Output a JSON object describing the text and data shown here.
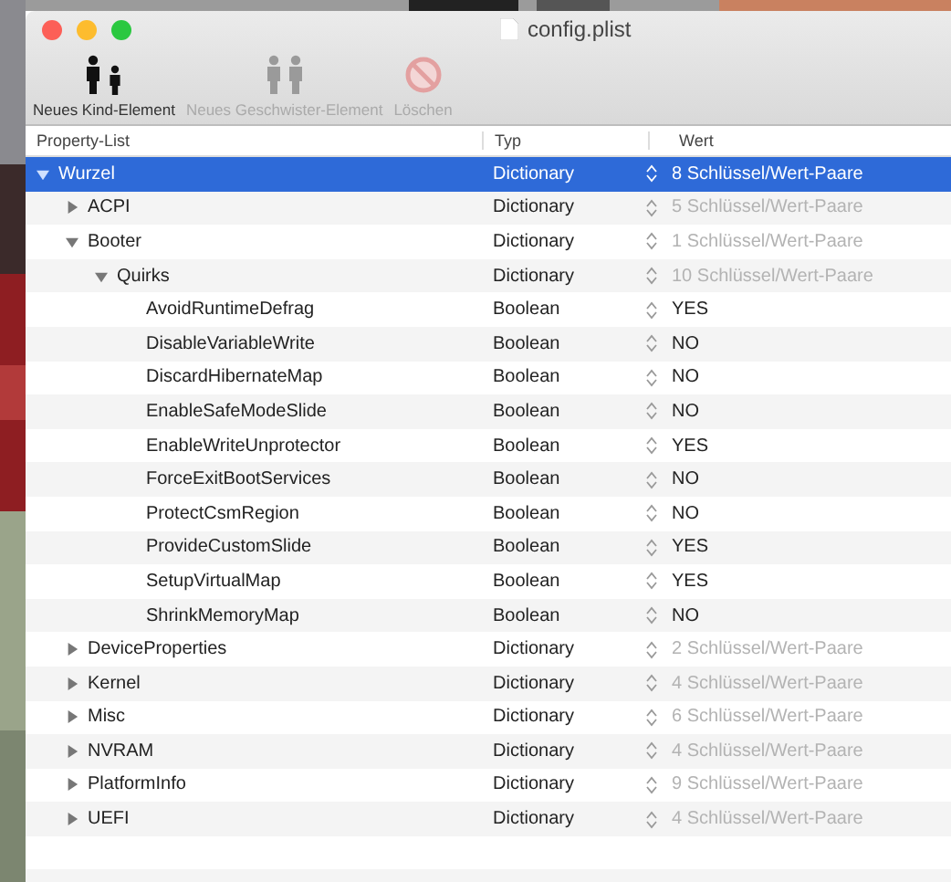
{
  "window": {
    "title": "config.plist"
  },
  "toolbar": [
    {
      "label": "Neues Kind-Element",
      "kind": "child",
      "disabled": false
    },
    {
      "label": "Neues Geschwister-Element",
      "kind": "sibling",
      "disabled": true
    },
    {
      "label": "Löschen",
      "kind": "delete",
      "disabled": true
    }
  ],
  "table": {
    "columns": [
      "Property-List",
      "Typ",
      "Wert"
    ],
    "rows": [
      {
        "key": "Wurzel",
        "type": "Dictionary",
        "kind": "dictionary",
        "value": "8 Schlüssel/Wert-Paare",
        "selected": true,
        "expanded": true,
        "children": [
          {
            "key": "ACPI",
            "type": "Dictionary",
            "kind": "dictionary",
            "value": "5 Schlüssel/Wert-Paare",
            "selected": false,
            "expanded": false
          },
          {
            "key": "Booter",
            "type": "Dictionary",
            "kind": "dictionary",
            "value": "1 Schlüssel/Wert-Paare",
            "selected": false,
            "expanded": true,
            "children": [
              {
                "key": "Quirks",
                "type": "Dictionary",
                "kind": "dictionary",
                "value": "10 Schlüssel/Wert-Paare",
                "selected": false,
                "expanded": true,
                "children": [
                  {
                    "key": "AvoidRuntimeDefrag",
                    "type": "Boolean",
                    "kind": "boolean",
                    "value": "YES",
                    "selected": false
                  },
                  {
                    "key": "DisableVariableWrite",
                    "type": "Boolean",
                    "kind": "boolean",
                    "value": "NO",
                    "selected": false
                  },
                  {
                    "key": "DiscardHibernateMap",
                    "type": "Boolean",
                    "kind": "boolean",
                    "value": "NO",
                    "selected": false
                  },
                  {
                    "key": "EnableSafeModeSlide",
                    "type": "Boolean",
                    "kind": "boolean",
                    "value": "NO",
                    "selected": false
                  },
                  {
                    "key": "EnableWriteUnprotector",
                    "type": "Boolean",
                    "kind": "boolean",
                    "value": "YES",
                    "selected": false
                  },
                  {
                    "key": "ForceExitBootServices",
                    "type": "Boolean",
                    "kind": "boolean",
                    "value": "NO",
                    "selected": false
                  },
                  {
                    "key": "ProtectCsmRegion",
                    "type": "Boolean",
                    "kind": "boolean",
                    "value": "NO",
                    "selected": false
                  },
                  {
                    "key": "ProvideCustomSlide",
                    "type": "Boolean",
                    "kind": "boolean",
                    "value": "YES",
                    "selected": false
                  },
                  {
                    "key": "SetupVirtualMap",
                    "type": "Boolean",
                    "kind": "boolean",
                    "value": "YES",
                    "selected": false
                  },
                  {
                    "key": "ShrinkMemoryMap",
                    "type": "Boolean",
                    "kind": "boolean",
                    "value": "NO",
                    "selected": false
                  }
                ]
              }
            ]
          },
          {
            "key": "DeviceProperties",
            "type": "Dictionary",
            "kind": "dictionary",
            "value": "2 Schlüssel/Wert-Paare",
            "selected": false,
            "expanded": false
          },
          {
            "key": "Kernel",
            "type": "Dictionary",
            "kind": "dictionary",
            "value": "4 Schlüssel/Wert-Paare",
            "selected": false,
            "expanded": false
          },
          {
            "key": "Misc",
            "type": "Dictionary",
            "kind": "dictionary",
            "value": "6 Schlüssel/Wert-Paare",
            "selected": false,
            "expanded": false
          },
          {
            "key": "NVRAM",
            "type": "Dictionary",
            "kind": "dictionary",
            "value": "4 Schlüssel/Wert-Paare",
            "selected": false,
            "expanded": false
          },
          {
            "key": "PlatformInfo",
            "type": "Dictionary",
            "kind": "dictionary",
            "value": "9 Schlüssel/Wert-Paare",
            "selected": false,
            "expanded": false
          },
          {
            "key": "UEFI",
            "type": "Dictionary",
            "kind": "dictionary",
            "value": "4 Schlüssel/Wert-Paare",
            "selected": false,
            "expanded": false
          }
        ]
      }
    ]
  }
}
